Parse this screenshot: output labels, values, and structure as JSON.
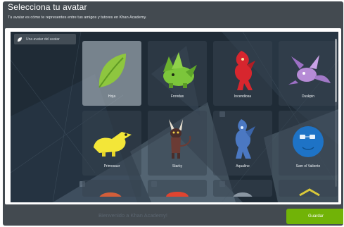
{
  "modal": {
    "title": "Selecciona tu avatar",
    "subtitle": "Tu avatar es cómo te representes entre tus amigos y tutores en Khan Academy."
  },
  "breadcrumb": {
    "label": "Una avatar del avatar"
  },
  "avatars": [
    {
      "label": "Hoja",
      "icon": "leaf-icon",
      "selected": true
    },
    {
      "label": "Frondas",
      "icon": "green-leaf-creature-icon",
      "selected": false
    },
    {
      "label": "Incendiosa",
      "icon": "red-fire-creature-icon",
      "selected": false
    },
    {
      "label": "Duskpin",
      "icon": "purple-winged-creature-icon",
      "selected": false
    },
    {
      "label": "Primosaur",
      "icon": "yellow-dinosaur-icon",
      "selected": false
    },
    {
      "label": "Starky",
      "icon": "horned-creature-icon",
      "selected": false
    },
    {
      "label": "Aqualine",
      "icon": "blue-water-creature-icon",
      "selected": false
    },
    {
      "label": "Sam el Valiente",
      "icon": "blue-round-creature-icon",
      "selected": false
    }
  ],
  "footer": {
    "text": "Bienvenido a Khan Academy!",
    "save_label": "Guardar"
  },
  "colors": {
    "save_button": "#71b307",
    "stage_background": "#1f2b36",
    "header_background": "#434a50"
  }
}
